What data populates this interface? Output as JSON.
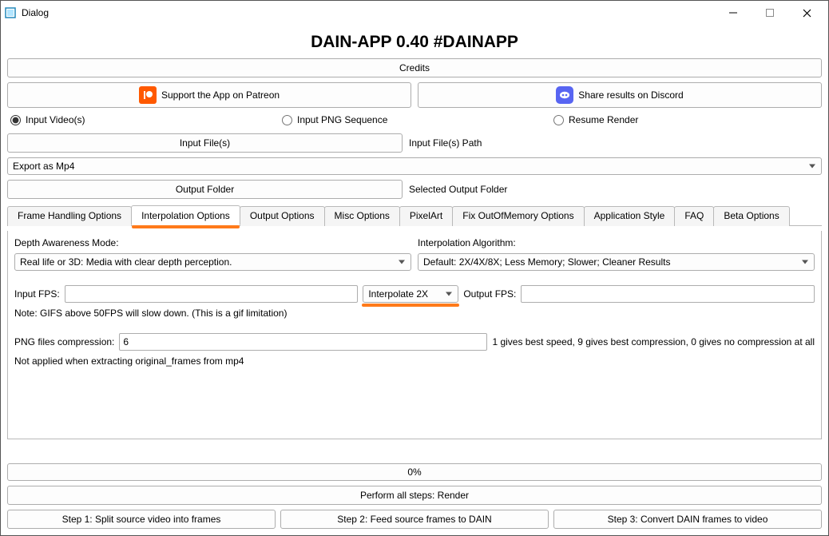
{
  "window": {
    "title": "Dialog"
  },
  "app": {
    "title": "DAIN-APP 0.40 #DAINAPP"
  },
  "buttons": {
    "credits": "Credits",
    "patreon": "Support the App on Patreon",
    "discord": "Share results on Discord",
    "input_files": "Input File(s)",
    "output_folder": "Output Folder",
    "perform_all": "Perform all steps: Render",
    "step1": "Step 1: Split source video into frames",
    "step2": "Step 2: Feed source frames to DAIN",
    "step3": "Step 3: Convert DAIN frames to video"
  },
  "radios": {
    "input_video": "Input Video(s)",
    "input_png": "Input PNG Sequence",
    "resume": "Resume Render"
  },
  "labels": {
    "input_files_path": "Input File(s) Path",
    "selected_output": "Selected Output Folder",
    "depth_mode": "Depth Awareness Mode:",
    "interp_algo": "Interpolation Algorithm:",
    "input_fps": "Input FPS:",
    "output_fps": "Output FPS:",
    "png_comp": "PNG files compression:"
  },
  "selects": {
    "export": "Export as Mp4",
    "depth_mode": "Real life or 3D: Media with clear depth perception.",
    "interp_algo": "Default: 2X/4X/8X; Less Memory; Slower; Cleaner Results",
    "interpolate": "Interpolate 2X"
  },
  "inputs": {
    "input_fps": "",
    "output_fps": "",
    "png_comp": "6"
  },
  "notes": {
    "gif": "Note: GIFS above 50FPS will slow down. (This is a gif limitation)",
    "png_help": "1 gives best speed, 9 gives best compression, 0 gives no compression at all",
    "png_note": "Not applied when extracting original_frames from mp4"
  },
  "tabs": [
    "Frame Handling Options",
    "Interpolation Options",
    "Output Options",
    "Misc Options",
    "PixelArt",
    "Fix OutOfMemory Options",
    "Application Style",
    "FAQ",
    "Beta Options"
  ],
  "progress": {
    "text": "0%"
  }
}
